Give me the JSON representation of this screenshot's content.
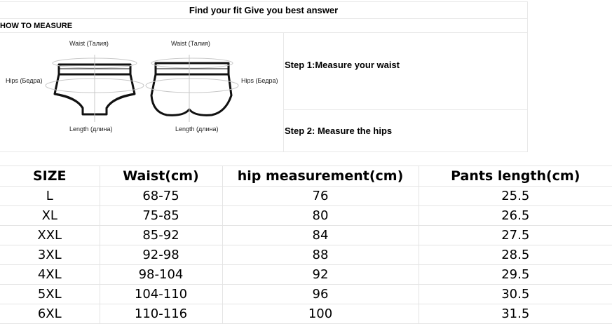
{
  "guide": {
    "title": "Find your fit Give you best answer",
    "how_to": "HOW TO MEASURE",
    "step1": "Step 1:Measure your waist",
    "step2": "Step 2: Measure the hips",
    "diagram_left": {
      "waist": "Waist (Талия)",
      "hips": "Hips (Бедра)",
      "length": "Length (длина)"
    },
    "diagram_right": {
      "waist": "Waist (Талия)",
      "hips": "Hips (Бедра)",
      "length": "Length (длина)"
    }
  },
  "size_table": {
    "headers": [
      "SIZE",
      "Waist(cm)",
      "hip measurement(cm)",
      "Pants length(cm)"
    ],
    "rows": [
      [
        "L",
        "68-75",
        "76",
        "25.5"
      ],
      [
        "XL",
        "75-85",
        "80",
        "26.5"
      ],
      [
        "XXL",
        "85-92",
        "84",
        "27.5"
      ],
      [
        "3XL",
        "92-98",
        "88",
        "28.5"
      ],
      [
        "4XL",
        "98-104",
        "92",
        "29.5"
      ],
      [
        "5XL",
        "104-110",
        "96",
        "30.5"
      ],
      [
        "6XL",
        "110-116",
        "100",
        "31.5"
      ]
    ]
  }
}
